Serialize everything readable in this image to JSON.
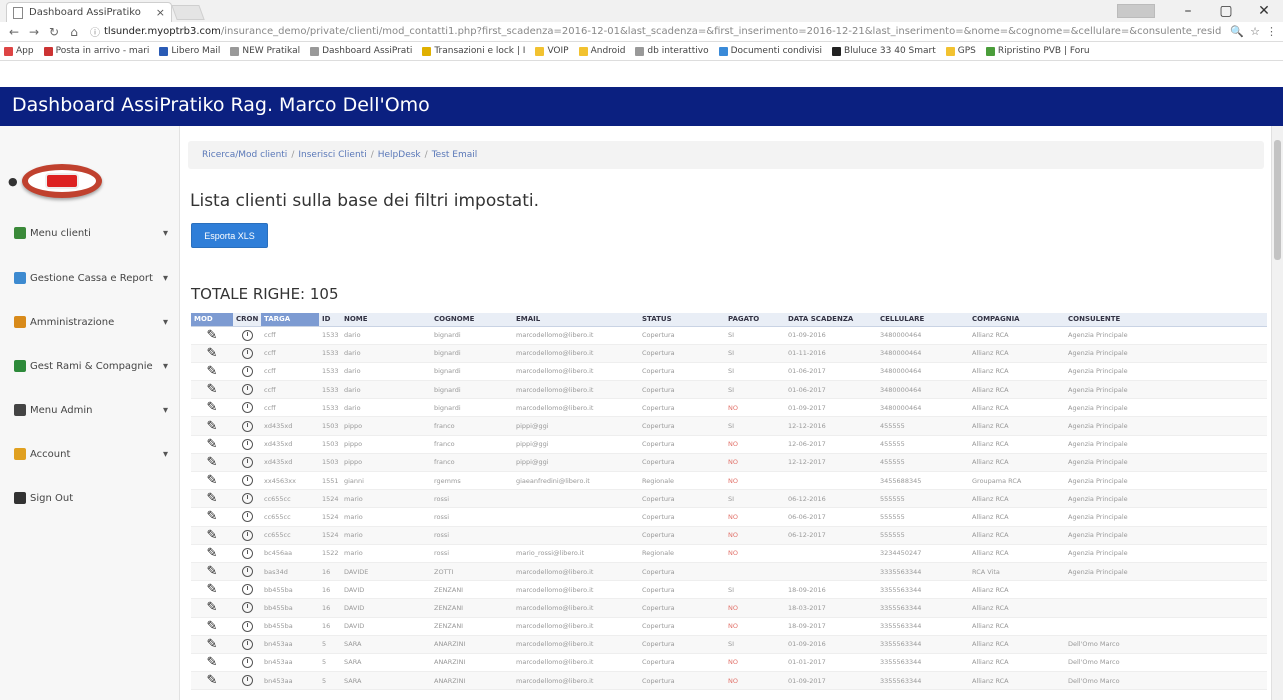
{
  "browser": {
    "tab_title": "Dashboard AssiPratiko",
    "tab_close": "×",
    "url_domain": "tlsunder.myoptrb3.com",
    "url_rest": "/insurance_demo/private/clienti/mod_contatti1.php?first_scadenza=2016-12-01&last_scadenza=&first_inserimento=2016-12-21&last_inserimento=&nome=&cognome=&cellulare=&consulente_resid",
    "window_controls": [
      "–",
      "▢",
      "✕"
    ],
    "bookmarks": [
      {
        "label": "App",
        "color": "#d44"
      },
      {
        "label": "Posta in arrivo - mari",
        "color": "#c33"
      },
      {
        "label": "Libero Mail",
        "color": "#2a5bb5"
      },
      {
        "label": "NEW Pratikal",
        "color": "#999"
      },
      {
        "label": "Dashboard AssiPrati",
        "color": "#999"
      },
      {
        "label": "Transazioni e lock | I",
        "color": "#e0b000"
      },
      {
        "label": "VOIP",
        "color": "#f2c230"
      },
      {
        "label": "Android",
        "color": "#f2c230"
      },
      {
        "label": "db interattivo",
        "color": "#999"
      },
      {
        "label": "Documenti condivisi",
        "color": "#3a8ad8"
      },
      {
        "label": "Bluluce 33 40 Smart",
        "color": "#222"
      },
      {
        "label": "GPS",
        "color": "#f2c230"
      },
      {
        "label": "Ripristino PVB | Foru",
        "color": "#4a9d3a"
      }
    ]
  },
  "app": {
    "brand": "Dashboard AssiPratiko Rag. Marco Dell'Omo",
    "header_color": "#0b2080"
  },
  "sidebar": {
    "items": [
      {
        "label": "Menu clienti",
        "icon": "users-icon",
        "color": "#3b8a3a"
      },
      {
        "label": "Gestione Cassa e Report",
        "icon": "report-icon",
        "color": "#3d8ad0"
      },
      {
        "label": "Amministrazione",
        "icon": "admin-icon",
        "color": "#d88a1a"
      },
      {
        "label": "Gest Rami & Compagnie",
        "icon": "companies-icon",
        "color": "#2d8a3a"
      },
      {
        "label": "Menu Admin",
        "icon": "admin-user-icon",
        "color": "#444"
      },
      {
        "label": "Account",
        "icon": "account-icon",
        "color": "#e0a020"
      },
      {
        "label": "Sign Out",
        "icon": "signout-icon",
        "color": "#333"
      }
    ],
    "caret": "▾"
  },
  "breadcrumb": [
    "Ricerca/Mod clienti",
    "Inserisci Clienti",
    "HelpDesk",
    "Test Email"
  ],
  "breadcrumb_sep": "/",
  "main": {
    "title": "Lista clienti sulla base dei filtri impostati.",
    "export_label": "Esporta XLS",
    "totale": "TOTALE RIGHE: 105"
  },
  "table": {
    "columns": [
      "MOD",
      "CRON",
      "TARGA",
      "ID",
      "NOME",
      "COGNOME",
      "EMAIL",
      "STATUS",
      "PAGATO",
      "DATA SCADENZA",
      "CELLULARE",
      "COMPAGNIA",
      "CONSULENTE"
    ],
    "rows": [
      [
        "",
        "",
        "ccff",
        "1533",
        "dario",
        "bignardi",
        "marcodellomo@libero.it",
        "Copertura",
        "SI",
        "01-09-2016",
        "3480000464",
        "Allianz RCA",
        "Agenzia Principale"
      ],
      [
        "",
        "",
        "ccff",
        "1533",
        "dario",
        "bignardi",
        "marcodellomo@libero.it",
        "Copertura",
        "SI",
        "01-11-2016",
        "3480000464",
        "Allianz RCA",
        "Agenzia Principale"
      ],
      [
        "",
        "",
        "ccff",
        "1533",
        "dario",
        "bignardi",
        "marcodellomo@libero.it",
        "Copertura",
        "SI",
        "01-06-2017",
        "3480000464",
        "Allianz RCA",
        "Agenzia Principale"
      ],
      [
        "",
        "",
        "ccff",
        "1533",
        "dario",
        "bignardi",
        "marcodellomo@libero.it",
        "Copertura",
        "SI",
        "01-06-2017",
        "3480000464",
        "Allianz RCA",
        "Agenzia Principale"
      ],
      [
        "",
        "",
        "ccff",
        "1533",
        "dario",
        "bignardi",
        "marcodellomo@libero.it",
        "Copertura",
        "NO",
        "01-09-2017",
        "3480000464",
        "Allianz RCA",
        "Agenzia Principale"
      ],
      [
        "",
        "",
        "xd435xd",
        "1503",
        "pippo",
        "franco",
        "pippi@ggi",
        "Copertura",
        "SI",
        "12-12-2016",
        "455555",
        "Allianz RCA",
        "Agenzia Principale"
      ],
      [
        "",
        "",
        "xd435xd",
        "1503",
        "pippo",
        "franco",
        "pippi@ggi",
        "Copertura",
        "NO",
        "12-06-2017",
        "455555",
        "Allianz RCA",
        "Agenzia Principale"
      ],
      [
        "",
        "",
        "xd435xd",
        "1503",
        "pippo",
        "franco",
        "pippi@ggi",
        "Copertura",
        "NO",
        "12-12-2017",
        "455555",
        "Allianz RCA",
        "Agenzia Principale"
      ],
      [
        "",
        "",
        "xx4563xx",
        "1551",
        "gianni",
        "rgemms",
        "giaeanfredini@libero.it",
        "Regionale",
        "NO",
        "",
        "3455688345",
        "Groupama RCA",
        "Agenzia Principale"
      ],
      [
        "",
        "",
        "cc655cc",
        "1524",
        "mario",
        "rossi",
        "",
        "Copertura",
        "SI",
        "06-12-2016",
        "555555",
        "Allianz RCA",
        "Agenzia Principale"
      ],
      [
        "",
        "",
        "cc655cc",
        "1524",
        "mario",
        "rossi",
        "",
        "Copertura",
        "NO",
        "06-06-2017",
        "555555",
        "Allianz RCA",
        "Agenzia Principale"
      ],
      [
        "",
        "",
        "cc655cc",
        "1524",
        "mario",
        "rossi",
        "",
        "Copertura",
        "NO",
        "06-12-2017",
        "555555",
        "Allianz RCA",
        "Agenzia Principale"
      ],
      [
        "",
        "",
        "bc456aa",
        "1522",
        "mario",
        "rossi",
        "mario_rossi@libero.it",
        "Regionale",
        "NO",
        "",
        "3234450247",
        "Allianz RCA",
        "Agenzia Principale"
      ],
      [
        "",
        "",
        "bas34d",
        "16",
        "DAVIDE",
        "ZOTTI",
        "marcodellomo@libero.it",
        "Copertura",
        "",
        "",
        "3335563344",
        "RCA Vita",
        "Agenzia Principale"
      ],
      [
        "",
        "",
        "bb455ba",
        "16",
        "DAVID",
        "ZENZANI",
        "marcodellomo@libero.it",
        "Copertura",
        "SI",
        "18-09-2016",
        "3355563344",
        "Allianz RCA",
        ""
      ],
      [
        "",
        "",
        "bb455ba",
        "16",
        "DAVID",
        "ZENZANI",
        "marcodellomo@libero.it",
        "Copertura",
        "NO",
        "18-03-2017",
        "3355563344",
        "Allianz RCA",
        ""
      ],
      [
        "",
        "",
        "bb455ba",
        "16",
        "DAVID",
        "ZENZANI",
        "marcodellomo@libero.it",
        "Copertura",
        "NO",
        "18-09-2017",
        "3355563344",
        "Allianz RCA",
        ""
      ],
      [
        "",
        "",
        "bn453aa",
        "5",
        "SARA",
        "ANARZINI",
        "marcodellomo@libero.it",
        "Copertura",
        "SI",
        "01-09-2016",
        "3355563344",
        "Allianz RCA",
        "Dell'Omo Marco"
      ],
      [
        "",
        "",
        "bn453aa",
        "5",
        "SARA",
        "ANARZINI",
        "marcodellomo@libero.it",
        "Copertura",
        "NO",
        "01-01-2017",
        "3355563344",
        "Allianz RCA",
        "Dell'Omo Marco"
      ],
      [
        "",
        "",
        "bn453aa",
        "5",
        "SARA",
        "ANARZINI",
        "marcodellomo@libero.it",
        "Copertura",
        "NO",
        "01-09-2017",
        "3355563344",
        "Allianz RCA",
        "Dell'Omo Marco"
      ]
    ]
  },
  "edit_glyph": "✎"
}
